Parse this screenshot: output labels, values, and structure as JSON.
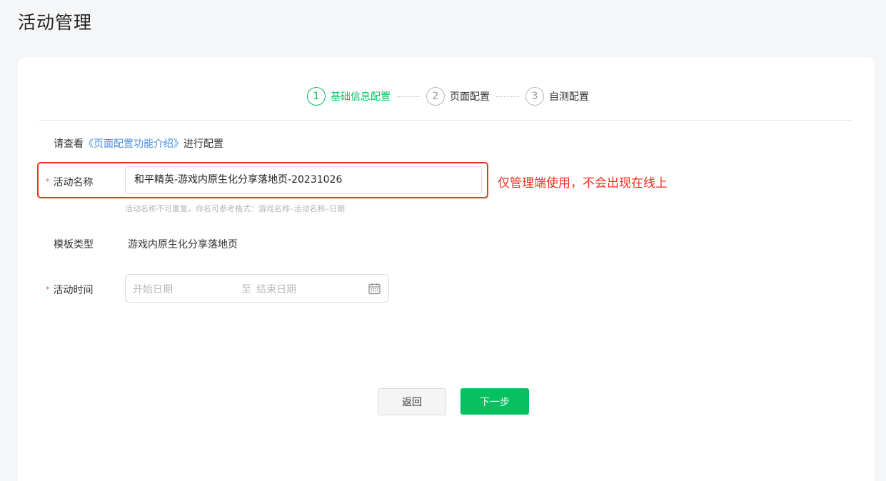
{
  "page": {
    "title": "活动管理"
  },
  "steps": [
    {
      "number": "1",
      "label": "基础信息配置",
      "active": true
    },
    {
      "number": "2",
      "label": "页面配置",
      "active": false
    },
    {
      "number": "3",
      "label": "自测配置",
      "active": false
    }
  ],
  "intro": {
    "prefix": "请查看",
    "link": "《页面配置功能介绍》",
    "suffix": "进行配置"
  },
  "form": {
    "required_mark": "*",
    "activity_name": {
      "label": "活动名称",
      "value": "和平精英-游戏内原生化分享落地页-20231026",
      "hint": "活动名称不可重复，命名可参考格式：游戏名称–活动名称–日期"
    },
    "template_type": {
      "label": "模板类型",
      "value": "游戏内原生化分享落地页"
    },
    "activity_time": {
      "label": "活动时间",
      "start_placeholder": "开始日期",
      "separator": "至",
      "end_placeholder": "结束日期",
      "icon": "calendar-icon"
    }
  },
  "annotation": {
    "text": "仅管理端使用，不会出现在线上",
    "color": "#f0301e"
  },
  "buttons": {
    "back": "返回",
    "next": "下一步"
  },
  "colors": {
    "accent": "#07c160",
    "link": "#4a90e2",
    "background": "#f5f6f7"
  }
}
